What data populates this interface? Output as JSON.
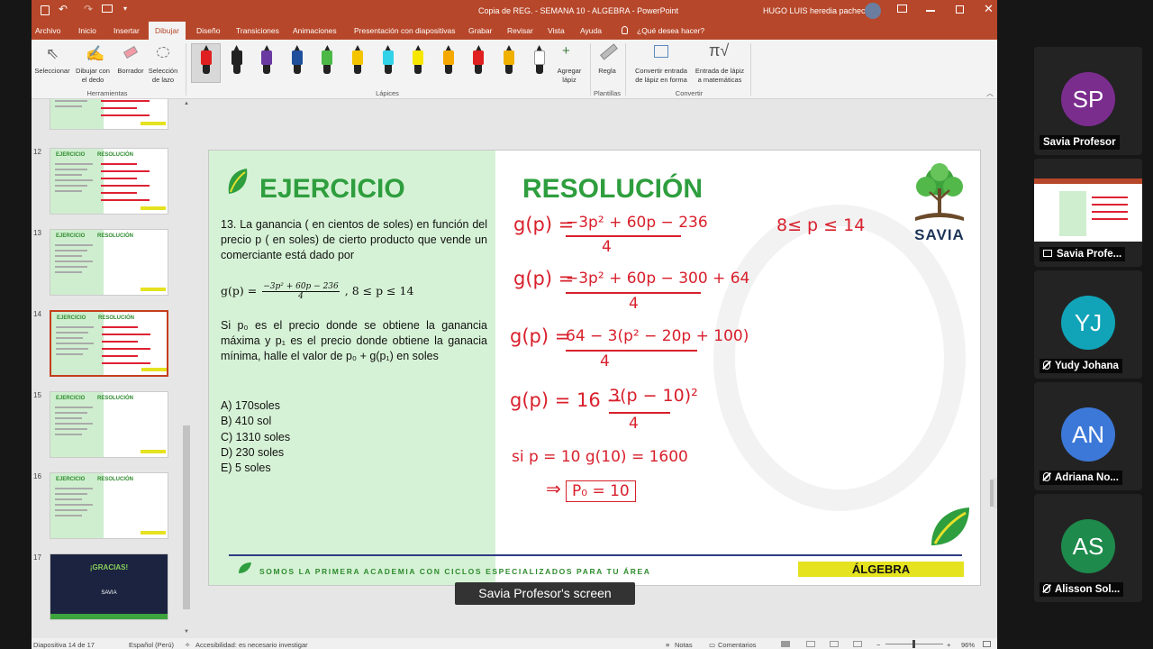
{
  "window": {
    "title": "Copia de REG. - SEMANA 10 - ALGEBRA  -  PowerPoint",
    "user": "HUGO LUIS heredia pacheco"
  },
  "ribbon_tabs": [
    "Archivo",
    "Inicio",
    "Insertar",
    "Dibujar",
    "Diseño",
    "Transiciones",
    "Animaciones",
    "Presentación con diapositivas",
    "Grabar",
    "Revisar",
    "Vista",
    "Ayuda"
  ],
  "tell_me": "¿Qué desea hacer?",
  "ribbon": {
    "select": "Seleccionar",
    "draw_finger_1": "Dibujar con",
    "draw_finger_2": "el dedo",
    "eraser": "Borrador",
    "lasso_1": "Selección",
    "lasso_2": "de lazo",
    "group_tools": "Herramientas",
    "group_pens": "Lápices",
    "add_pen_1": "Agregar",
    "add_pen_2": "lápiz",
    "ruler": "Regla",
    "group_stencils": "Plantillas",
    "ink_shape_1": "Convertir entrada",
    "ink_shape_2": "de lápiz en forma",
    "ink_math_1": "Entrada de lápiz",
    "ink_math_2": "a matemáticas",
    "group_convert": "Convertir",
    "pen_colors": [
      "#e02020",
      "#222222",
      "#6a3aa0",
      "#1f4e9c",
      "#4cb848",
      "#f4c400",
      "#32d2e8",
      "#f7e600",
      "#f5a800",
      "#e02020",
      "#f0b000",
      "#ffffff"
    ]
  },
  "thumbnails": [
    {
      "num": "",
      "title_left": "",
      "title_right": ""
    },
    {
      "num": "12",
      "title_left": "EJERCICIO",
      "title_right": "RESOLUCIÓN"
    },
    {
      "num": "13",
      "title_left": "EJERCICIO",
      "title_right": "RESOLUCIÓN"
    },
    {
      "num": "14",
      "title_left": "EJERCICIO",
      "title_right": "RESOLUCIÓN"
    },
    {
      "num": "15",
      "title_left": "EJERCICIO",
      "title_right": "RESOLUCIÓN"
    },
    {
      "num": "16",
      "title_left": "EJERCICIO",
      "title_right": "RESOLUCIÓN"
    },
    {
      "num": "17",
      "title_left": "¡GRACIAS!",
      "title_right": "SAVIA"
    }
  ],
  "slide": {
    "exercise_title": "EJERCICIO",
    "resolution_title": "RESOLUCIÓN",
    "brand": "SAVIA",
    "problem_text": "13. La ganancia ( en cientos de soles) en función del precio p ( en soles) de cierto producto que vende un comerciante está dado por",
    "formula_lhs": "g(p) =",
    "formula_num": "−3p² + 60p − 236",
    "formula_den": "4",
    "formula_cond": ", 8 ≤ p ≤ 14",
    "question_text": "Si p₀ es el precio donde se obtiene la ganancia máxima y p₁ es el precio donde obtiene la ganacia mínima, halle el valor de p₀ + g(p₁) en soles",
    "options": [
      "A) 170soles",
      "B) 410 sol",
      "C) 1310 soles",
      "D) 230 soles",
      "E) 5 soles"
    ],
    "footer": "SOMOS LA PRIMERA ACADEMIA CON CICLOS ESPECIALIZADOS PARA TU ÁREA",
    "subject": "ÁLGEBRA",
    "handwriting": {
      "domain": "8≤ p ≤ 14",
      "l1_lhs": "g(p) =",
      "l1_num": "−3p² + 60p − 236",
      "l1_den": "4",
      "l2_lhs": "g(p) =",
      "l2_num": "−3p² + 60p − 300 + 64",
      "l2_den": "4",
      "l3_lhs": "g(p) =",
      "l3_num": "64 − 3(p² − 20p + 100)",
      "l3_den": "4",
      "l4_lhs": "g(p) = 16 −",
      "l4_num": "3(p − 10)²",
      "l4_den": "4",
      "l5": "si  p = 10   g(10) = 1600",
      "l6_arrow": "⇒",
      "l6_box": "P₀ = 10"
    }
  },
  "status": {
    "slide_info": "Diapositiva 14 de 17",
    "language": "Español (Perú)",
    "accessibility": "Accesibilidad: es necesario investigar",
    "notes": "Notas",
    "comments": "Comentarios",
    "zoom": "96%"
  },
  "share_label": "Savia Profesor's screen",
  "participants": [
    {
      "initials": "SP",
      "name": "Savia Profesor",
      "color": "#7b2d8e",
      "muted": false
    },
    {
      "initials": "",
      "name": "Savia Profe...",
      "color": "#232323",
      "muted": false
    },
    {
      "initials": "YJ",
      "name": "Yudy Johana",
      "color": "#11a4b8",
      "muted": true
    },
    {
      "initials": "AN",
      "name": "Adriana No...",
      "color": "#3c78d8",
      "muted": true
    },
    {
      "initials": "AS",
      "name": "Alisson Sol...",
      "color": "#1e8a4c",
      "muted": true
    }
  ]
}
